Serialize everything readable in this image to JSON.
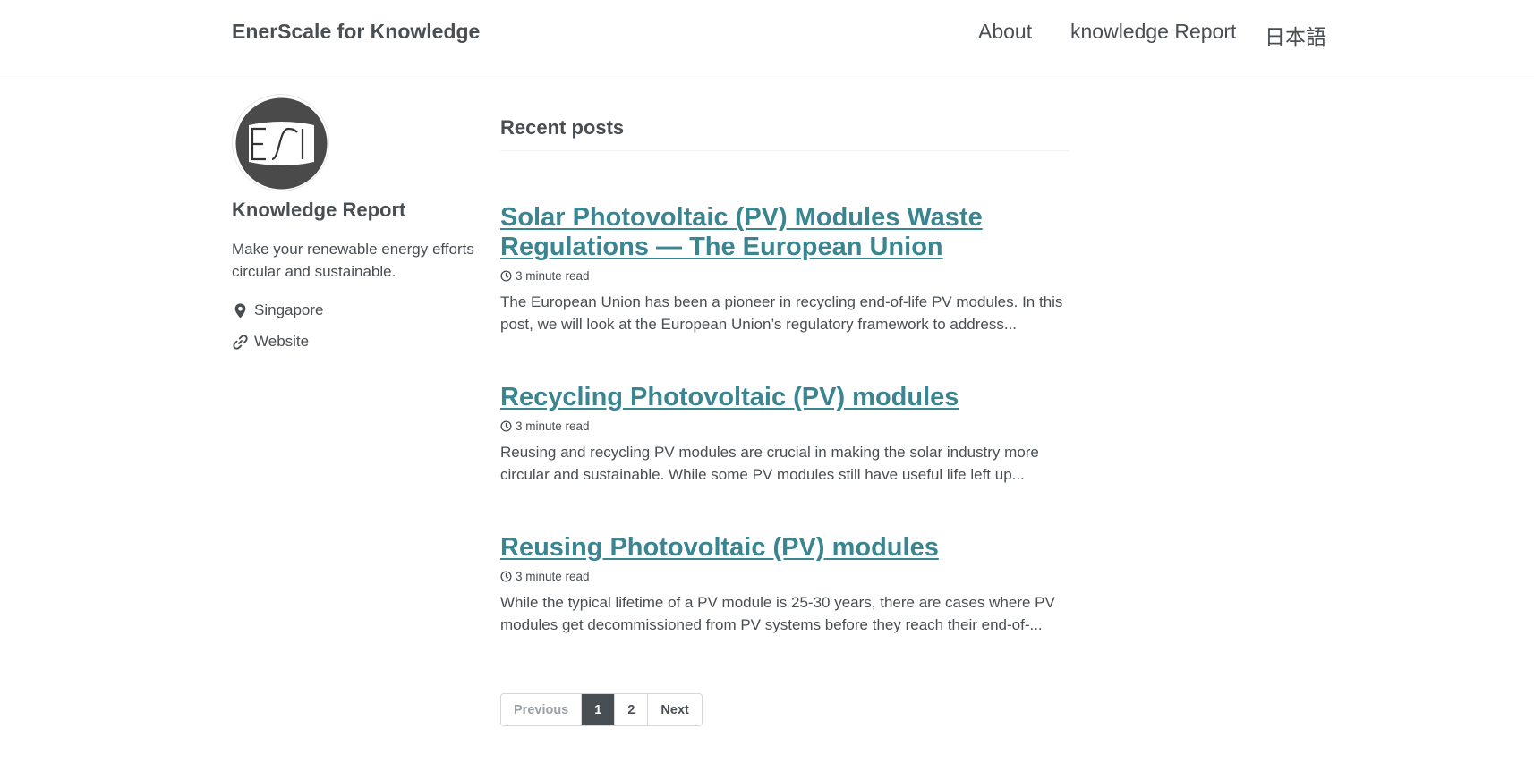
{
  "header": {
    "site_title": "EnerScale for Knowledge",
    "nav": [
      {
        "label": "About"
      },
      {
        "label": "knowledge Report"
      },
      {
        "label": "日本語"
      }
    ]
  },
  "sidebar": {
    "author_name": "Knowledge Report",
    "bio": "Make your renewable energy efforts circular and sustainable.",
    "location": "Singapore",
    "website_label": "Website",
    "location_icon": "map-marker-icon",
    "website_icon": "link-icon"
  },
  "main": {
    "section_title": "Recent posts",
    "posts": [
      {
        "title": "Solar Photovoltaic (PV) Modules Waste Regulations — The European Union",
        "read_time": "3 minute read",
        "excerpt": "The European Union has been a pioneer in recycling end-of-life PV modules. In this post, we will look at the European Union’s regulatory framework to address..."
      },
      {
        "title": "Recycling Photovoltaic (PV) modules",
        "read_time": "3 minute read",
        "excerpt": "Reusing and recycling PV modules are crucial in making the solar industry more circular and sustainable. While some PV modules still have useful life left up..."
      },
      {
        "title": "Reusing Photovoltaic (PV) modules",
        "read_time": "3 minute read",
        "excerpt": "While the typical lifetime of a PV module is 25-30 years, there are cases where PV modules get decommissioned from PV systems before they reach their end-of-..."
      }
    ]
  },
  "pagination": {
    "previous": "Previous",
    "pages": [
      "1",
      "2"
    ],
    "current_page": "1",
    "next": "Next"
  },
  "colors": {
    "link": "#3a8590",
    "text": "#494e52",
    "current_page_bg": "#494e52"
  }
}
